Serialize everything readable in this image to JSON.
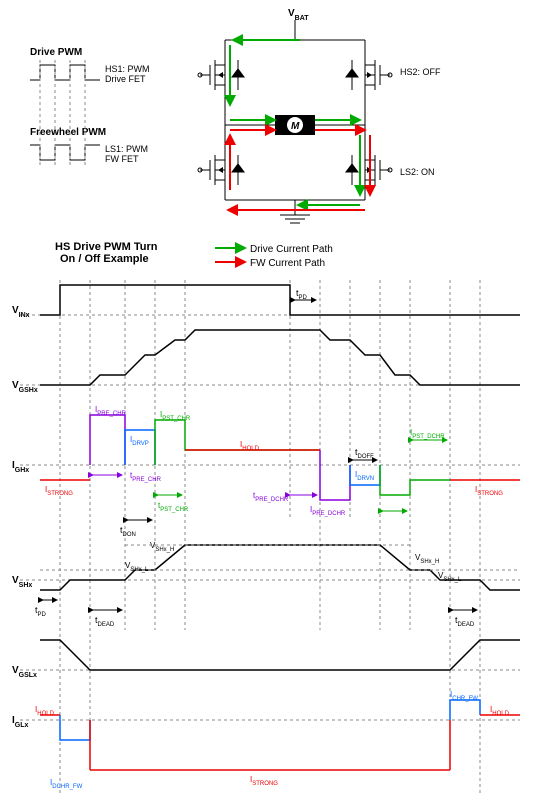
{
  "vbat": "V",
  "vbat_sub": "BAT",
  "drive_pwm": "Drive PWM",
  "freewheel_pwm": "Freewheel PWM",
  "hs1": "HS1: PWM\nDrive FET",
  "hs2": "HS2: OFF",
  "ls1": "LS1: PWM\nFW FET",
  "ls2": "LS2: ON",
  "motor": "M",
  "title": "HS Drive PWM Turn\nOn / Off Example",
  "drive_path": "Drive Current Path",
  "fw_path": "FW Current Path",
  "vin": "V",
  "vin_sub": "INx",
  "tpd": "t",
  "tpd_sub": "PD",
  "vgshx": "V",
  "vgshx_sub": "GSHx",
  "ighx": "I",
  "ighx_sub": "GHx",
  "vshx": "V",
  "vshx_sub": "SHx",
  "vgslx": "V",
  "vgslx_sub": "GSLx",
  "iglx": "I",
  "iglx_sub": "GLx",
  "ipre_chr": "I",
  "ipre_chr_sub": "PRE_CHR",
  "ipst_chr": "I",
  "ipst_chr_sub": "PST_CHR",
  "idrvp": "I",
  "idrvp_sub": "DRVP",
  "ihold": "I",
  "ihold_sub": "HOLD",
  "tdoff": "t",
  "tdoff_sub": "DOFF",
  "ipst_dchr": "I",
  "ipst_dchr_sub": "PST_DCHR",
  "tpre_chr": "t",
  "tpre_chr_sub": "PRE_CHR",
  "tpst_chr": "t",
  "tpst_chr_sub": "PST_CHR",
  "tpre_dchr": "t",
  "tpre_dchr_sub": "PRE_DCHR",
  "ipre_dchr": "I",
  "ipre_dchr_sub": "PRE_DCHR",
  "idrvn": "I",
  "idrvn_sub": "DRVN",
  "istrong": "I",
  "istrong_sub": "STRONG",
  "tdon": "t",
  "tdon_sub": "DON",
  "vshx_h": "V",
  "vshx_h_sub": "SHx_H",
  "vshx_l": "V",
  "vshx_l_sub": "SHx_L",
  "tdead": "t",
  "tdead_sub": "DEAD",
  "ichr_fw": "I",
  "ichr_fw_sub": "CHR_FW",
  "idchr_fw": "I",
  "idchr_fw_sub": "DCHR_FW"
}
